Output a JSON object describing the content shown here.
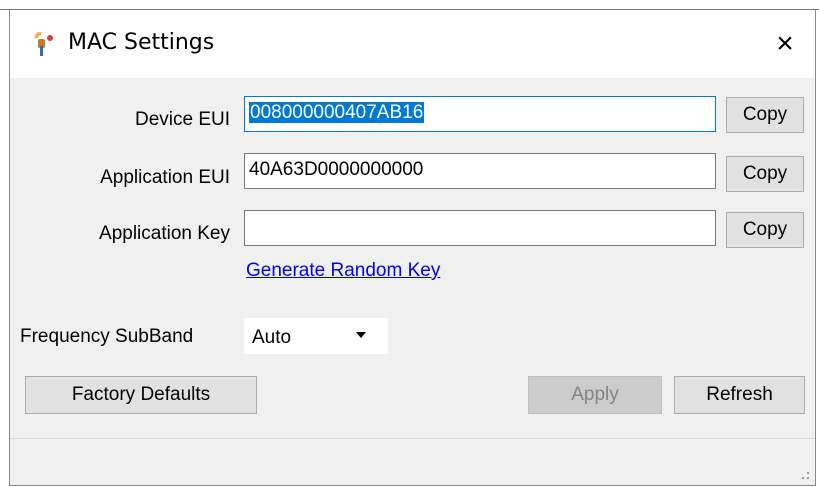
{
  "window": {
    "title": "MAC Settings",
    "close_glyph": "×"
  },
  "fields": {
    "device_eui": {
      "label": "Device EUI",
      "value": "008000000407AB16"
    },
    "application_eui": {
      "label": "Application EUI",
      "value": "40A63D0000000000"
    },
    "application_key": {
      "label": "Application Key",
      "value": ""
    }
  },
  "buttons": {
    "copy": "Copy",
    "factory_defaults": "Factory Defaults",
    "apply": "Apply",
    "refresh": "Refresh"
  },
  "generate_random_key": "Generate Random Key",
  "frequency_subband": {
    "label": "Frequency SubBand",
    "value": "Auto"
  },
  "colors": {
    "selection": "#0078d7",
    "link": "#0000ee"
  },
  "icons": {
    "app": "satellite-antenna-icon",
    "close": "close-icon",
    "dropdown": "chevron-down-icon",
    "grip": "resize-grip-icon"
  }
}
